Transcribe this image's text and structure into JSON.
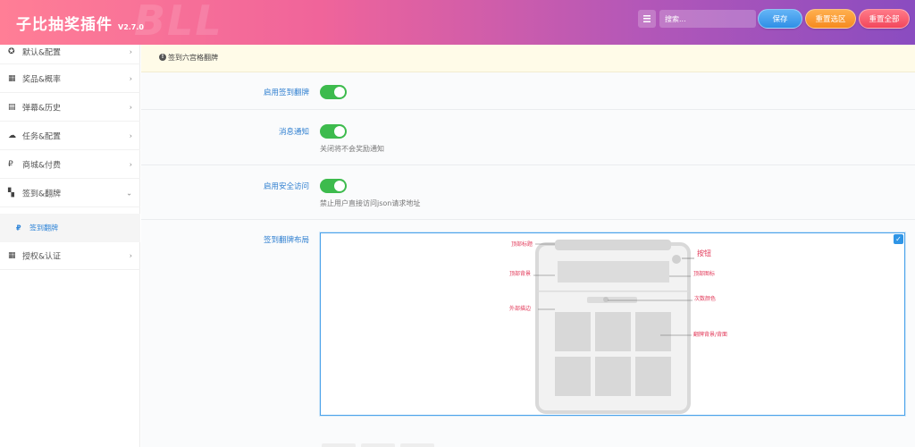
{
  "header": {
    "watermark": "BLL",
    "title": "子比抽奖插件",
    "version": "V2.7.0",
    "search_placeholder": "搜索...",
    "buttons": {
      "save": "保存",
      "reset_selected": "重置选区",
      "reset_all": "重置全部"
    }
  },
  "sidebar": {
    "items": [
      {
        "icon": "settings-icon",
        "label": "默认&配置"
      },
      {
        "icon": "calendar-icon",
        "label": "奖品&概率"
      },
      {
        "icon": "map-icon",
        "label": "弹幕&历史"
      },
      {
        "icon": "cloud-icon",
        "label": "任务&配置"
      },
      {
        "icon": "ruble-icon",
        "label": "商城&付费"
      },
      {
        "icon": "checkerboard-icon",
        "label": "签到&翻牌"
      },
      {
        "icon": "calendar-icon",
        "label": "授权&认证"
      }
    ],
    "sub_item": {
      "icon": "ruble-icon",
      "label": "签到翻牌"
    }
  },
  "notice": {
    "text": "签到六宫格翻牌"
  },
  "form": {
    "enable_flip": {
      "label": "启用签到翻牌",
      "on": true
    },
    "notify": {
      "label": "消息通知",
      "on": true,
      "desc": "关闭将不会奖励通知"
    },
    "safe_access": {
      "label": "启用安全访问",
      "on": true,
      "desc": "禁止用户直接访问json请求地址"
    },
    "layout": {
      "label": "签到翻牌布局",
      "annotations": {
        "top_title": "顶部标题",
        "top_bg": "顶部背景",
        "outer_border": "外部描边",
        "button": "按钮",
        "bottom_sticker": "顶部图标",
        "times_color": "次数颜色",
        "card": "翻牌背景/背面"
      }
    }
  },
  "colors": {
    "accent": "#2f85d8",
    "toggle_on": "#3dbb4d",
    "save": "#2f8fe6",
    "reset_selected": "#f68a1f",
    "reset_all": "#f2475c"
  }
}
